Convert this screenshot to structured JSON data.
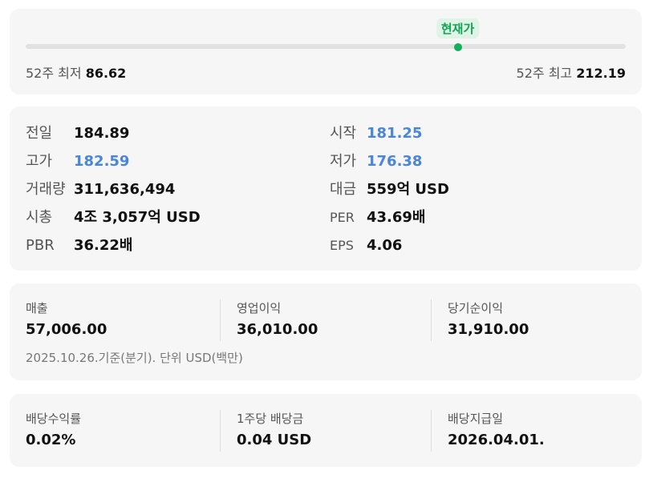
{
  "range": {
    "current_tag": "현재가",
    "position_fraction": 0.72,
    "low_label": "52주 최저",
    "low_value": "86.62",
    "high_label": "52주 최고",
    "high_value": "212.19",
    "marker_color": "#13b05b"
  },
  "stats": [
    {
      "label": "전일",
      "value": "184.89",
      "color": "default"
    },
    {
      "label": "시작",
      "value": "181.25",
      "color": "blue"
    },
    {
      "label": "고가",
      "value": "182.59",
      "color": "blue"
    },
    {
      "label": "저가",
      "value": "176.38",
      "color": "blue"
    },
    {
      "label": "거래량",
      "value": "311,636,494",
      "color": "default"
    },
    {
      "label": "대금",
      "value": "559억 USD",
      "color": "default"
    },
    {
      "label": "시총",
      "value": "4조 3,057억 USD",
      "color": "default"
    },
    {
      "label": "PER",
      "value": "43.69배",
      "color": "default"
    },
    {
      "label": "PBR",
      "value": "36.22배",
      "color": "default"
    },
    {
      "label": "EPS",
      "value": "4.06",
      "color": "default"
    }
  ],
  "financials": {
    "items": [
      {
        "label": "매출",
        "value": "57,006.00"
      },
      {
        "label": "영업이익",
        "value": "36,010.00"
      },
      {
        "label": "당기순이익",
        "value": "31,910.00"
      }
    ],
    "note": "2025.10.26.기준(분기). 단위 USD(백만)"
  },
  "dividends": {
    "items": [
      {
        "label": "배당수익률",
        "value": "0.02%"
      },
      {
        "label": "1주당 배당금",
        "value": "0.04 USD"
      },
      {
        "label": "배당지급일",
        "value": "2026.04.01."
      }
    ]
  },
  "colors": {
    "accent_blue": "#4a86d8",
    "card_bg": "#f6f6f6",
    "green": "#13a356"
  }
}
